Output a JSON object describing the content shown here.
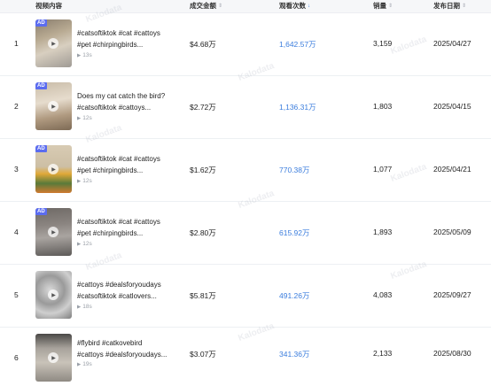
{
  "headers": {
    "video": "视频内容",
    "amount": "成交金额",
    "views": "观看次数",
    "sales": "销量",
    "date": "发布日期"
  },
  "watermark": "Kalodata",
  "ad_badge": "AD",
  "rows": [
    {
      "index": "1",
      "ad": true,
      "line1": "#catsoftiktok #cat #cattoys",
      "line2": "#pet #chirpingbirds...",
      "duration": "13s",
      "amount": "$4.68万",
      "views": "1,642.57万",
      "sales": "3,159",
      "date": "2025/04/27"
    },
    {
      "index": "2",
      "ad": true,
      "line1": "Does my cat catch the bird?",
      "line2": "#catsoftiktok #cattoys...",
      "duration": "12s",
      "amount": "$2.72万",
      "views": "1,136.31万",
      "sales": "1,803",
      "date": "2025/04/15"
    },
    {
      "index": "3",
      "ad": true,
      "line1": "#catsoftiktok #cat #cattoys",
      "line2": "#pet #chirpingbirds...",
      "duration": "12s",
      "amount": "$1.62万",
      "views": "770.38万",
      "sales": "1,077",
      "date": "2025/04/21"
    },
    {
      "index": "4",
      "ad": true,
      "line1": "#catsoftiktok #cat #cattoys",
      "line2": "#pet #chirpingbirds...",
      "duration": "12s",
      "amount": "$2.80万",
      "views": "615.92万",
      "sales": "1,893",
      "date": "2025/05/09"
    },
    {
      "index": "5",
      "ad": false,
      "line1": "#cattoys #dealsforyoudays",
      "line2": "#catsoftiktok #catlovers...",
      "duration": "18s",
      "amount": "$5.81万",
      "views": "491.26万",
      "sales": "4,083",
      "date": "2025/09/27"
    },
    {
      "index": "6",
      "ad": false,
      "line1": "#flybird #catkovebird",
      "line2": "#cattoys #dealsforyoudays...",
      "duration": "19s",
      "amount": "$3.07万",
      "views": "341.36万",
      "sales": "2,133",
      "date": "2025/08/30"
    }
  ],
  "colors": {
    "accent": "#3b7ddd",
    "ad_badge": "#5b6cf0"
  }
}
